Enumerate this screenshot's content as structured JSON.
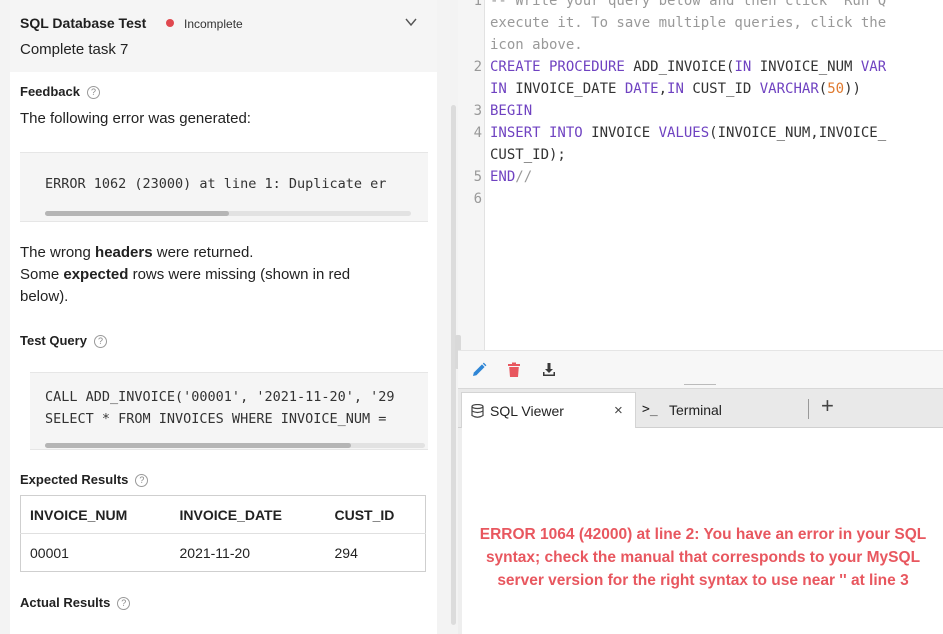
{
  "task": {
    "title": "SQL Database Test",
    "status": "Incomplete",
    "subtitle": "Complete task 7"
  },
  "feedback": {
    "label": "Feedback",
    "intro": "The following error was generated:",
    "error_code": "ERROR 1062 (23000) at line 1: Duplicate er",
    "wrong_prefix": "The wrong ",
    "wrong_bold": "headers",
    "wrong_suffix": " were returned.",
    "missing_prefix": "Some ",
    "missing_bold": "expected",
    "missing_suffix": " rows were missing (shown in red",
    "missing_line2": "below)."
  },
  "test_query": {
    "label": "Test Query",
    "lines": [
      "CALL ADD_INVOICE('00001', '2021-11-20', '29",
      "SELECT * FROM INVOICES WHERE INVOICE_NUM ="
    ]
  },
  "expected": {
    "label": "Expected Results",
    "columns": [
      "INVOICE_NUM",
      "INVOICE_DATE",
      "CUST_ID"
    ],
    "rows": [
      [
        "00001",
        "2021-11-20",
        "294"
      ]
    ]
  },
  "actual": {
    "label": "Actual Results"
  },
  "editor": {
    "line_numbers": [
      "1",
      "2",
      "3",
      "4",
      "5",
      "6"
    ],
    "comment_1": "-- Write your query below and then click \"Run Q",
    "comment_2": "execute it. To save multiple queries, click the",
    "comment_3": "icon above.",
    "l2_kw1": "CREATE PROCEDURE",
    "l2_name": " ADD_INVOICE(",
    "l2_kw2": "IN",
    "l2_rest": " INVOICE_NUM ",
    "l2_kw3": "VAR",
    "l2b_kw1": "IN",
    "l2b_mid": " INVOICE_DATE ",
    "l2b_kw2": "DATE",
    "l2b_sep": ",",
    "l2b_kw3": "IN",
    "l2b_mid2": " CUST_ID ",
    "l2b_kw4": "VARCHAR",
    "l2b_open": "(",
    "l2b_num": "50",
    "l2b_close": "))",
    "l3_kw": "BEGIN",
    "l4_kw1": "INSERT INTO",
    "l4_mid": " INVOICE ",
    "l4_kw2": "VALUES",
    "l4_rest": "(INVOICE_NUM,INVOICE_",
    "l4b": "CUST_ID);",
    "l5_kw": "END",
    "l5_cmt": "//"
  },
  "tabs": {
    "sql_viewer": "SQL Viewer",
    "close": "×",
    "terminal_prompt": ">_",
    "terminal": "Terminal",
    "add": "+"
  },
  "output": {
    "error": "ERROR 1064 (42000) at line 2: You have an error in your SQL syntax; check the manual that corresponds to your MySQL server version for the right syntax to use near '' at line 3"
  },
  "icons": {
    "edit": "pencil-icon",
    "delete": "trash-icon",
    "download": "download-icon",
    "database": "database-icon",
    "help": "help-circle-icon",
    "chevron": "chevron-down-icon"
  },
  "colors": {
    "error_red": "#e8575f",
    "status_red": "#e0484f",
    "keyword_purple": "#6f42c1",
    "number_orange": "#e07a2f",
    "edit_blue": "#2f86d6"
  }
}
